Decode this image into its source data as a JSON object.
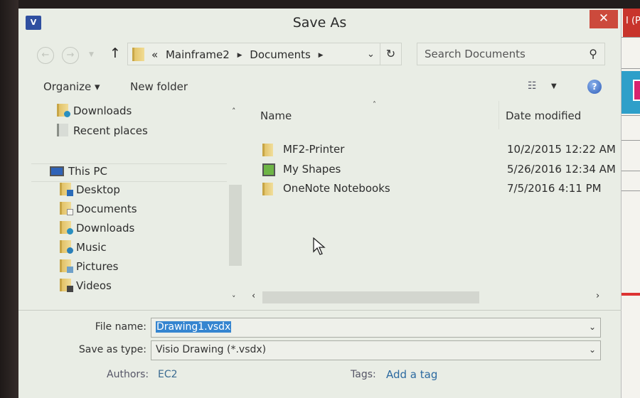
{
  "window": {
    "title": "Save As",
    "app_icon_label": "V",
    "close_glyph": "✕"
  },
  "background_app": {
    "tab_text": "I (P",
    "accent_red": "#c8342c",
    "accent_blue": "#2e9fc9",
    "accent_magenta": "#d8246e"
  },
  "navbar": {
    "back_glyph": "←",
    "forward_glyph": "→",
    "history_glyph": "▼",
    "up_glyph": "↑",
    "breadcrumb_prefix": "«",
    "breadcrumb": [
      "Mainframe2",
      "Documents"
    ],
    "separator_glyph": "▶",
    "address_dropdown_glyph": "⌄",
    "refresh_glyph": "↻",
    "search_placeholder": "Search Documents",
    "search_glyph": "⚲"
  },
  "toolbar": {
    "organize_label": "Organize ▾",
    "new_folder_label": "New folder",
    "view_glyph": "☷",
    "view_dropdown_glyph": "▼",
    "help_glyph": "?"
  },
  "nav_pane": {
    "items_top": [
      {
        "label": "Downloads",
        "icon": "downloads-folder-icon"
      },
      {
        "label": "Recent places",
        "icon": "recent-places-icon"
      }
    ],
    "this_pc_label": "This PC",
    "pc_items": [
      {
        "label": "Desktop",
        "icon": "desktop-folder-icon"
      },
      {
        "label": "Documents",
        "icon": "documents-folder-icon"
      },
      {
        "label": "Downloads",
        "icon": "downloads-folder-icon"
      },
      {
        "label": "Music",
        "icon": "music-folder-icon"
      },
      {
        "label": "Pictures",
        "icon": "pictures-folder-icon"
      },
      {
        "label": "Videos",
        "icon": "videos-folder-icon"
      }
    ],
    "scroll_up_glyph": "˄",
    "scroll_down_glyph": "˅"
  },
  "file_list": {
    "columns": {
      "name": "Name",
      "date": "Date modified"
    },
    "sort_glyph": "˄",
    "rows": [
      {
        "name": "MF2-Printer",
        "date": "10/2/2015 12:22 AM",
        "type": "folder"
      },
      {
        "name": "My Shapes",
        "date": "5/26/2016 12:34 AM",
        "type": "shapes-folder"
      },
      {
        "name": "OneNote Notebooks",
        "date": "7/5/2016 4:11 PM",
        "type": "folder"
      }
    ],
    "scroll_left_glyph": "‹",
    "scroll_right_glyph": "›"
  },
  "form": {
    "file_name_label": "File name:",
    "file_name_value": "Drawing1.vsdx",
    "save_type_label": "Save as type:",
    "save_type_value": "Visio Drawing (*.vsdx)",
    "dropdown_glyph": "⌄",
    "authors_label": "Authors:",
    "authors_value": "EC2",
    "tags_label": "Tags:",
    "tags_link": "Add a tag"
  }
}
